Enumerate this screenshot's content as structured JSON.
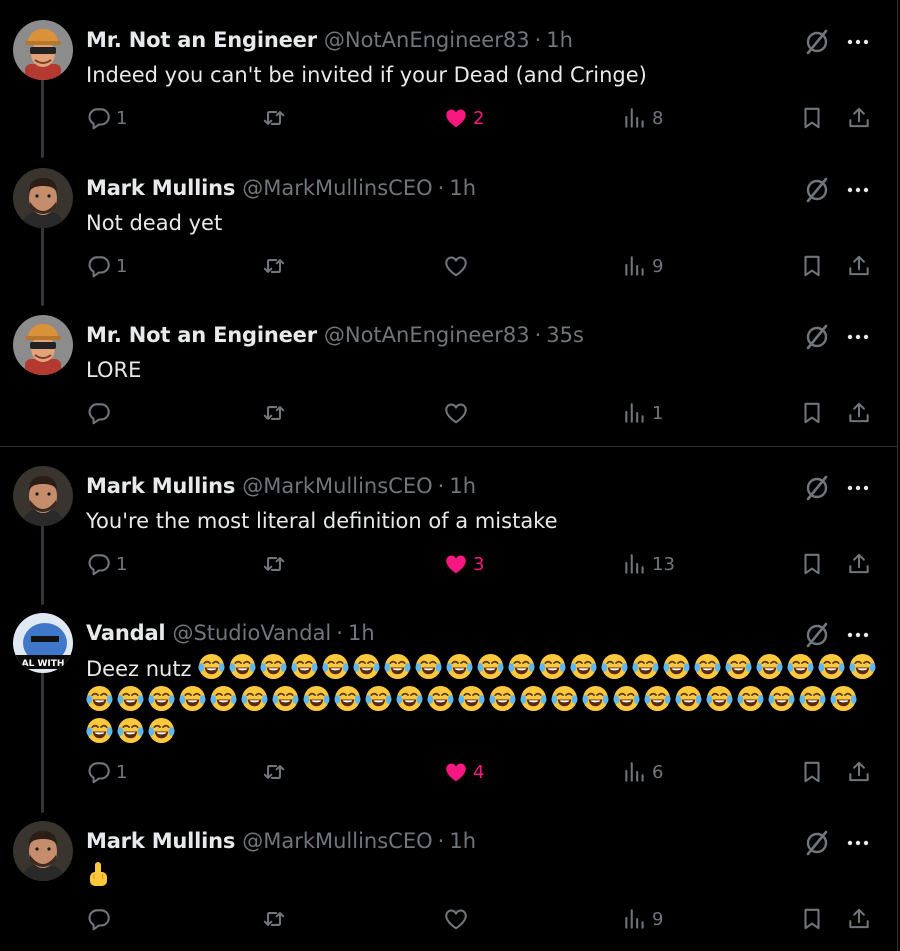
{
  "tweets": [
    {
      "name": "Mr. Not an Engineer",
      "handle": "@NotAnEngineer83",
      "time": "1h",
      "text": "Indeed you can't be invited if your Dead (and Cringe)",
      "emoji_count": 0,
      "avatar_icon": "tf2-engineer-avatar",
      "replies": "1",
      "likes": "2",
      "liked": true,
      "views": "8"
    },
    {
      "name": "Mark Mullins",
      "handle": "@MarkMullinsCEO",
      "time": "1h",
      "text": "Not dead yet",
      "emoji_count": 0,
      "avatar_icon": "man-portrait-avatar",
      "replies": "1",
      "likes": "",
      "liked": false,
      "views": "9"
    },
    {
      "name": "Mr. Not an Engineer",
      "handle": "@NotAnEngineer83",
      "time": "35s",
      "text": "LORE",
      "emoji_count": 0,
      "avatar_icon": "tf2-engineer-avatar",
      "replies": "",
      "likes": "",
      "liked": false,
      "views": "1"
    },
    {
      "name": "Mark Mullins",
      "handle": "@MarkMullinsCEO",
      "time": "1h",
      "text": "You're the most literal definition of a mistake",
      "emoji_count": 0,
      "avatar_icon": "man-portrait-avatar",
      "replies": "1",
      "likes": "3",
      "liked": true,
      "views": "13"
    },
    {
      "name": "Vandal",
      "handle": "@StudioVandal",
      "time": "1h",
      "text": "Deez nutz",
      "emoji": "😂",
      "emoji_count": 50,
      "avatar_icon": "blue-creature-sunglasses-avatar",
      "avatar_text": "AL WITH",
      "replies": "1",
      "likes": "4",
      "liked": true,
      "views": "6"
    },
    {
      "name": "Mark Mullins",
      "handle": "@MarkMullinsCEO",
      "time": "1h",
      "text": "🖕",
      "emoji_count": 0,
      "avatar_icon": "man-portrait-avatar",
      "replies": "",
      "likes": "",
      "liked": false,
      "views": "9"
    }
  ],
  "icons": {
    "reply": "reply-icon",
    "retweet": "retweet-icon",
    "like": "heart-icon",
    "views": "views-icon",
    "bookmark": "bookmark-icon",
    "share": "share-icon",
    "grok": "grok-icon",
    "more": "more-icon"
  },
  "colors": {
    "background": "#000000",
    "text": "#e7e9ea",
    "muted": "#71767b",
    "like": "#f91880",
    "border": "#2f3336"
  }
}
